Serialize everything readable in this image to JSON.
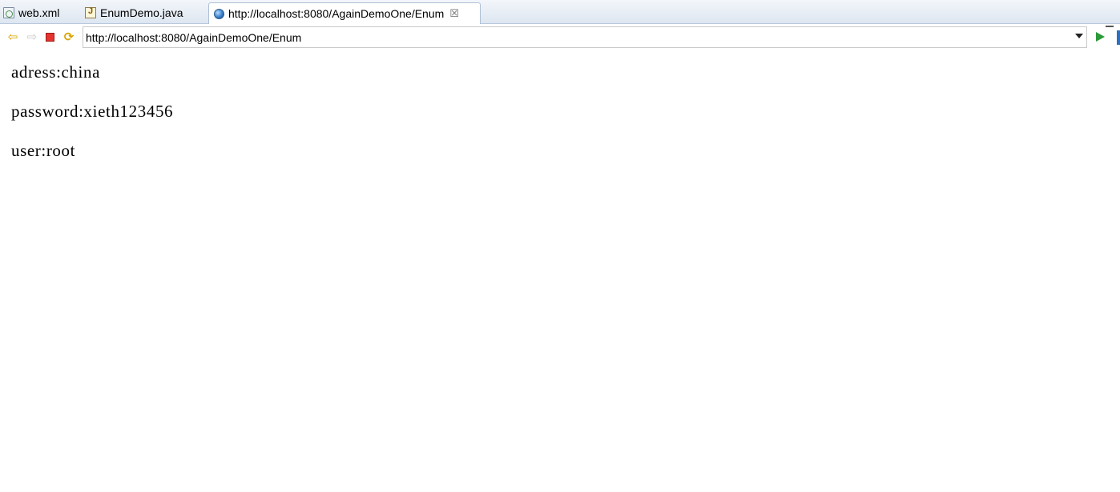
{
  "tabs": [
    {
      "label": "web.xml",
      "icon": "xml-file-icon"
    },
    {
      "label": "EnumDemo.java",
      "icon": "java-file-icon"
    },
    {
      "label": "http://localhost:8080/AgainDemoOne/Enum",
      "icon": "globe-icon",
      "close": "☒"
    }
  ],
  "toolbar": {
    "url_value": "http://localhost:8080/AgainDemoOne/Enum"
  },
  "content": {
    "lines": [
      "adress:china",
      "password:xieth123456",
      "user:root"
    ]
  },
  "colors": {
    "accent": "#2f6fc0",
    "go": "#2a9a3a",
    "stop": "#e3342f",
    "nav": "#d9a400"
  }
}
